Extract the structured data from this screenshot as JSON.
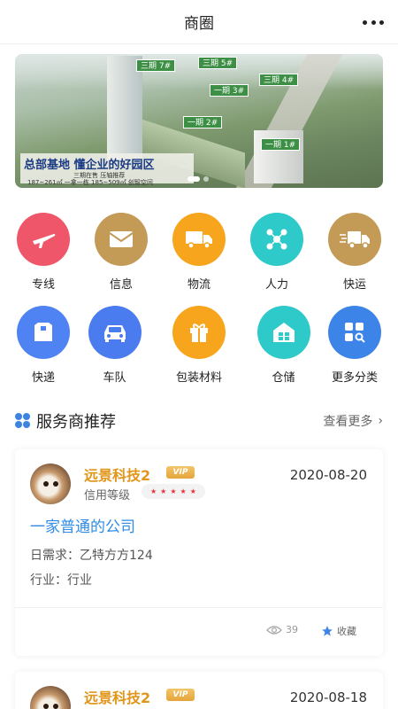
{
  "header": {
    "title": "商圈",
    "more_icon": "more-dots-icon"
  },
  "banner": {
    "caption_main": "总部基地  懂企业的好园区",
    "caption_sub_1": "三期在售 压轴推荐",
    "caption_sub_2": "187~261㎡ 一拿一栋  185~509㎡ 创智空间",
    "tags": [
      "三期 7#",
      "三期 5#",
      "一期 3#",
      "三期 4#",
      "一期 2#",
      "一期 1#"
    ]
  },
  "grid": {
    "row1": [
      {
        "label": "专线",
        "icon": "airplane-icon",
        "color": "#f0566a"
      },
      {
        "label": "信息",
        "icon": "envelope-icon",
        "color": "#c49a57"
      },
      {
        "label": "物流",
        "icon": "truck-icon",
        "color": "#f7a51c"
      },
      {
        "label": "人力",
        "icon": "network-icon",
        "color": "#2ec9c9"
      },
      {
        "label": "快运",
        "icon": "fast-truck-icon",
        "color": "#c49a57"
      }
    ],
    "row2": [
      {
        "label": "快递",
        "icon": "package-icon",
        "color": "#4f82f3"
      },
      {
        "label": "车队",
        "icon": "car-icon",
        "color": "#4a7cf0"
      },
      {
        "label": "包装材料",
        "icon": "gift-icon",
        "color": "#f7a51c"
      },
      {
        "label": "仓储",
        "icon": "warehouse-icon",
        "color": "#2ec9c9"
      },
      {
        "label": "更多分类",
        "icon": "grid-search-icon",
        "color": "#3d84e8"
      }
    ]
  },
  "section": {
    "title": "服务商推荐",
    "more_label": "查看更多"
  },
  "cards": [
    {
      "company": "远景科技2",
      "vip": "VIP",
      "date": "2020-08-20",
      "credit_label": "信用等级",
      "stars": 5,
      "description": "一家普通的公司",
      "daily_demand": "日需求：乙特方方124",
      "industry": "行业：行业",
      "views": "39",
      "favorite_label": "收藏"
    },
    {
      "company": "远景科技2",
      "vip": "VIP",
      "date": "2020-08-18"
    }
  ],
  "colors": {
    "accent": "#2f8be6",
    "company": "#e0961b",
    "star": "#e8323c"
  }
}
